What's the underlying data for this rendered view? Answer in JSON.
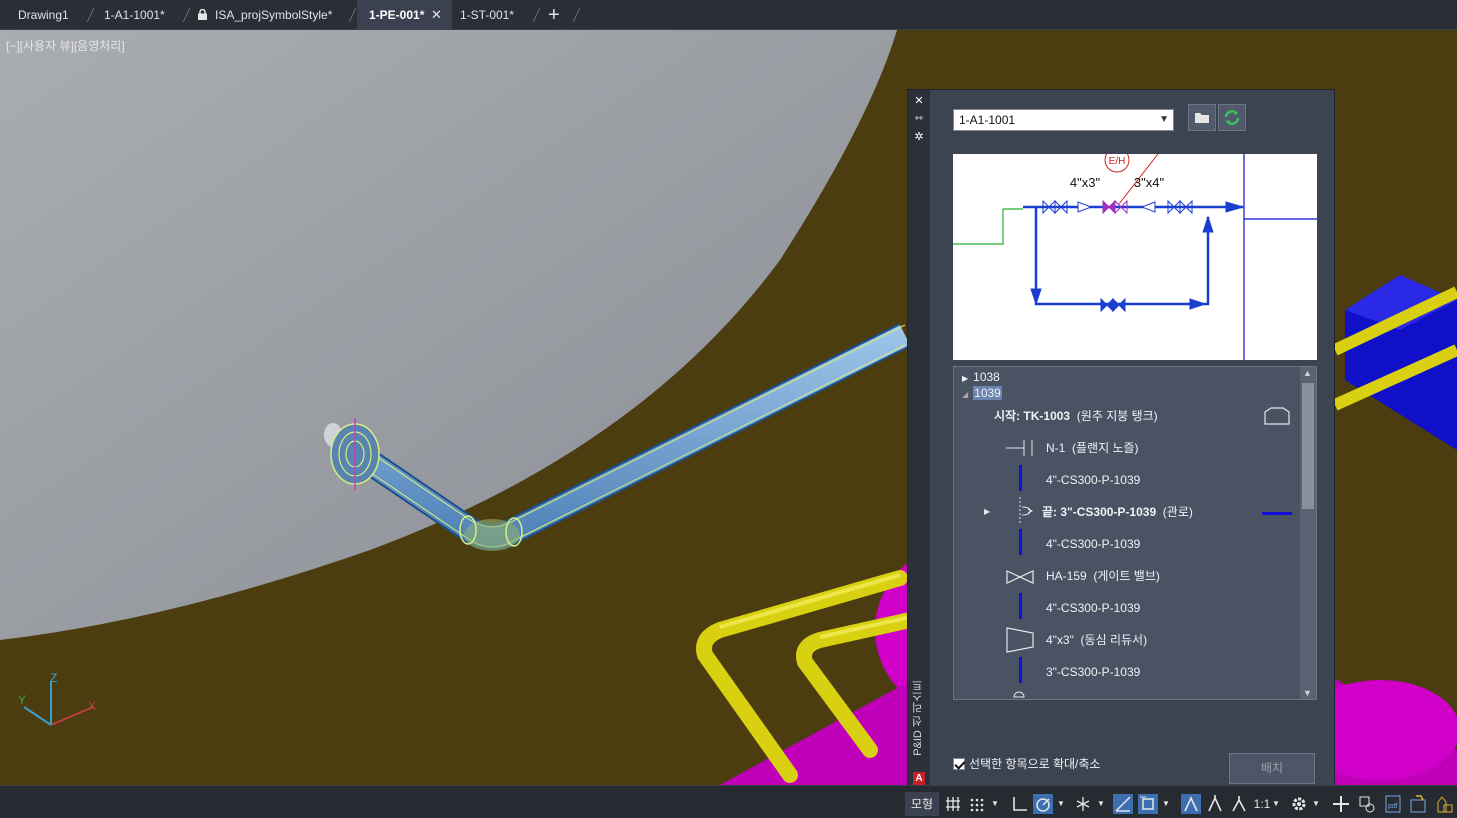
{
  "tabs": [
    {
      "label": "Drawing1",
      "active": false,
      "locked": false,
      "closable": false
    },
    {
      "label": "1-A1-1001*",
      "active": false,
      "locked": false,
      "closable": false
    },
    {
      "label": "ISA_projSymbolStyle*",
      "active": false,
      "locked": true,
      "closable": false
    },
    {
      "label": "1-PE-001*",
      "active": true,
      "locked": false,
      "closable": true
    },
    {
      "label": "1-ST-001*",
      "active": false,
      "locked": false,
      "closable": false
    }
  ],
  "viewport": {
    "label": "[−][사용자 뷰][음영처리]"
  },
  "panel": {
    "title": "P&ID 선 리스트",
    "drawing_select": "1-A1-1001",
    "preview": {
      "tag_eh": "E/H",
      "label_left": "4\"x3\"",
      "label_right": "3\"x4\""
    },
    "tree": [
      {
        "text": "1038",
        "bold": ""
      },
      {
        "text": "1039",
        "bold": ""
      },
      {
        "prefix": "시작: ",
        "bold": "TK-1003",
        "rest": "  (원추 지붕 탱크)"
      },
      {
        "prefix": "",
        "bold": "",
        "rest": "N-1  (플랜지 노즐)"
      },
      {
        "prefix": "",
        "bold": "",
        "rest": "4\"-CS300-P-1039"
      },
      {
        "prefix": "끝: ",
        "bold": "3\"-CS300-P-1039",
        "rest": "  (관로)"
      },
      {
        "prefix": "",
        "bold": "",
        "rest": "4\"-CS300-P-1039"
      },
      {
        "prefix": "",
        "bold": "",
        "rest": "HA-159  (게이트 밸브)"
      },
      {
        "prefix": "",
        "bold": "",
        "rest": "4\"-CS300-P-1039"
      },
      {
        "prefix": "",
        "bold": "",
        "rest": "4\"x3\"  (동심 리듀서)"
      },
      {
        "prefix": "",
        "bold": "",
        "rest": "3\"-CS300-P-1039"
      }
    ],
    "zoom_checkbox": "선택한 항목으로 확대/축소",
    "zoom_checked": true,
    "place_button": "배치"
  },
  "statusbar": {
    "model": "모형",
    "scale": "1:1"
  }
}
